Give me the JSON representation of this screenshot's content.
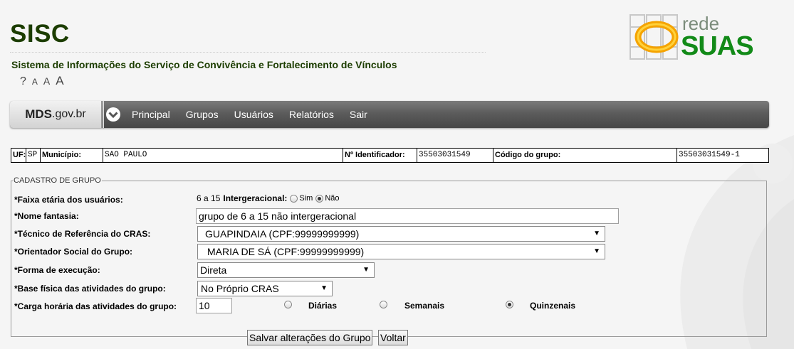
{
  "header": {
    "app_title": "SISC",
    "subtitle": "Sistema de Informações do Serviço de Convivência e Fortalecimento de Vínculos",
    "text_size": {
      "help": "?",
      "small": "A",
      "medium": "A",
      "large": "A"
    },
    "logo": {
      "rede": "rede",
      "suas": "SUAS"
    }
  },
  "nav": {
    "mds": "MDS",
    "mds_suffix": ".gov.br",
    "items": [
      "Principal",
      "Grupos",
      "Usuários",
      "Relatórios",
      "Sair"
    ]
  },
  "info": {
    "uf_label": "UF:",
    "uf_value": "SP",
    "municipio_label": "Município:",
    "municipio_value": "SAO PAULO",
    "identificador_label": "Nº Identificador:",
    "identificador_value": "35503031549",
    "codigo_label": "Código do grupo:",
    "codigo_value": "35503031549-1"
  },
  "form": {
    "legend": "CADASTRO DE GRUPO",
    "faixa_label": "*Faixa etária dos usuários:",
    "faixa_value": "6 a 15",
    "intergeracional_label": "Intergeracional:",
    "sim": "Sim",
    "nao": "Não",
    "intergeracional_selected": "Não",
    "nome_label": "*Nome fantasia:",
    "nome_value": "grupo de 6 a 15 não intergeracional",
    "tecnico_label": "*Técnico de Referência do CRAS:",
    "tecnico_value": "GUAPINDAIA (CPF:99999999999)",
    "orientador_label": "*Orientador Social do Grupo:",
    "orientador_value": "MARIA DE SÁ (CPF:99999999999)",
    "forma_label": "*Forma de execução:",
    "forma_value": "Direta",
    "base_label": "*Base física das atividades do grupo:",
    "base_value": "No Próprio CRAS",
    "carga_label": "*Carga horária das atividades do grupo:",
    "carga_value": "10",
    "diarias": "Diárias",
    "semanais": "Semanais",
    "quinzenais": "Quinzenais",
    "carga_selected": "Quinzenais",
    "save_button": "Salvar alterações do Grupo",
    "back_button": "Voltar"
  },
  "icons": {
    "nav": "chevron-down-icon",
    "logo": "rede-suas-logo-icon"
  },
  "colors": {
    "brand_green": "#1c3d00",
    "logo_green": "#128a18",
    "logo_orange": "#f5a300",
    "nav_dark": "#5c5c5c"
  }
}
